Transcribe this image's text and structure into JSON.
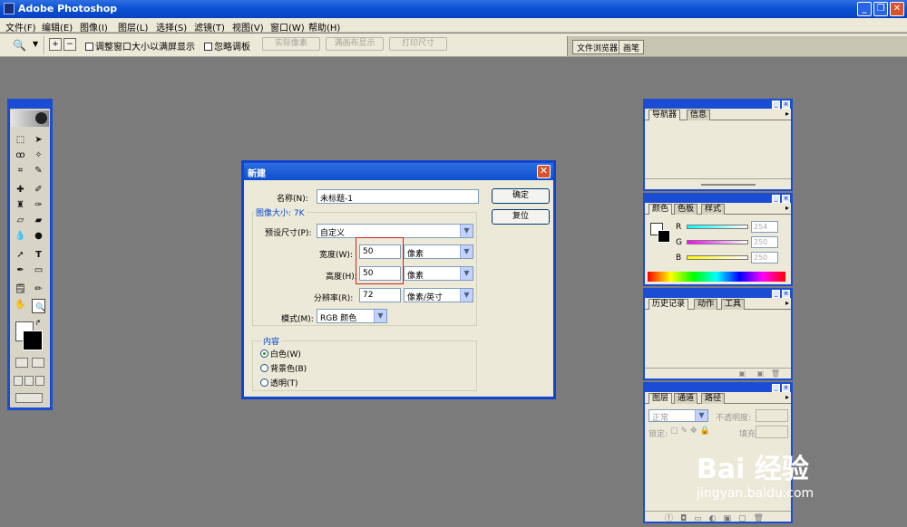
{
  "app": {
    "title": "Adobe Photoshop"
  },
  "menu": [
    "文件(F)",
    "编辑(E)",
    "图像(I)",
    "图层(L)",
    "选择(S)",
    "滤镜(T)",
    "视图(V)",
    "窗口(W)",
    "帮助(H)"
  ],
  "options": {
    "resize_windows": "调整窗口大小以满屏显示",
    "ignore_palettes": "忽略调板",
    "actual_pixels": "实际像素",
    "fit_on_screen": "满画布显示",
    "print_size": "打印尺寸"
  },
  "palette_well": {
    "tab1": "文件浏览器",
    "tab2": "画笔"
  },
  "toolbox": {
    "tools": [
      "marquee",
      "move",
      "lasso",
      "magic-wand",
      "crop",
      "slice",
      "healing",
      "brush",
      "stamp",
      "history-brush",
      "eraser",
      "gradient",
      "blur",
      "dodge",
      "path-select",
      "type",
      "pen",
      "shape",
      "notes",
      "eyedropper",
      "hand",
      "zoom"
    ]
  },
  "panels": {
    "navigator": {
      "tabs": [
        "导航器",
        "信息"
      ]
    },
    "color": {
      "tabs": [
        "颜色",
        "色板",
        "样式"
      ],
      "channels": [
        {
          "label": "R",
          "value": "254"
        },
        {
          "label": "G",
          "value": "250"
        },
        {
          "label": "B",
          "value": "250"
        }
      ]
    },
    "history": {
      "tabs": [
        "历史记录",
        "动作",
        "工具"
      ]
    },
    "layers": {
      "tabs": [
        "图层",
        "通道",
        "路径"
      ],
      "blend_mode": "正常",
      "opacity_label": "不透明度:",
      "lock_label": "锁定:",
      "fill_label": "填充:"
    }
  },
  "dialog": {
    "title": "新建",
    "name_label": "名称(N):",
    "name_value": "未标题-1",
    "ok": "确定",
    "reset": "复位",
    "image_size_group": "图像大小: 7K",
    "preset_label": "预设尺寸(P):",
    "preset_value": "自定义",
    "width_label": "宽度(W):",
    "width_value": "50",
    "width_unit": "像素",
    "height_label": "高度(H):",
    "height_value": "50",
    "height_unit": "像素",
    "resolution_label": "分辨率(R):",
    "resolution_value": "72",
    "resolution_unit": "像素/英寸",
    "mode_label": "模式(M):",
    "mode_value": "RGB 颜色",
    "contents_group": "内容",
    "contents_options": [
      "白色(W)",
      "背景色(B)",
      "透明(T)"
    ],
    "contents_selected": 0
  },
  "watermark": {
    "logo": "Bai 经验",
    "url": "jingyan.baidu.com"
  }
}
